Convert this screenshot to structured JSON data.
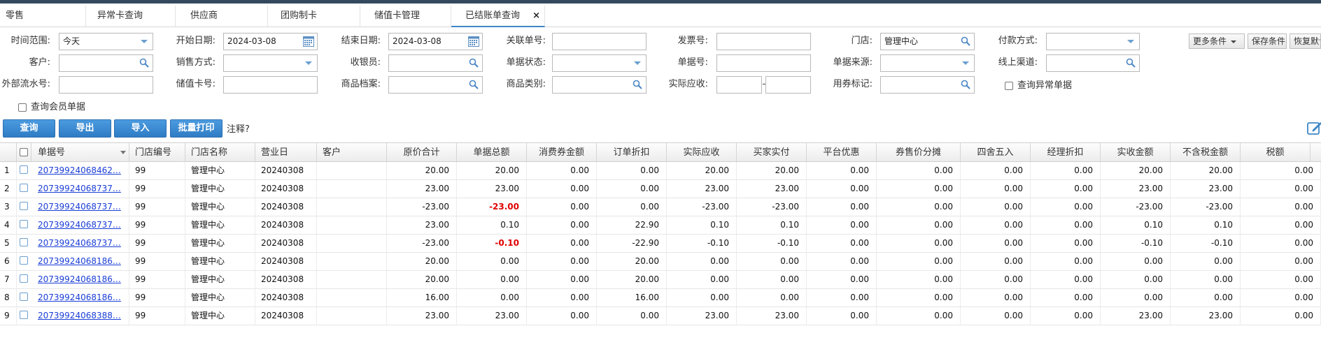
{
  "tabs": [
    {
      "label": "零售",
      "active": false
    },
    {
      "label": "异常卡查询",
      "active": false
    },
    {
      "label": "供应商",
      "active": false
    },
    {
      "label": "团购制卡",
      "active": false
    },
    {
      "label": "储值卡管理",
      "active": false
    },
    {
      "label": "已结账单查询",
      "active": true,
      "close": "×"
    }
  ],
  "form": {
    "time_range": {
      "label": "时间范围:",
      "value": "今天"
    },
    "start_date": {
      "label": "开始日期:",
      "value": "2024-03-08"
    },
    "end_date": {
      "label": "结束日期:",
      "value": "2024-03-08"
    },
    "related_no": {
      "label": "关联单号:",
      "value": ""
    },
    "invoice_no": {
      "label": "发票号:",
      "value": ""
    },
    "store": {
      "label": "门店:",
      "value": "管理中心"
    },
    "pay_method": {
      "label": "付款方式:",
      "value": ""
    },
    "customer": {
      "label": "客户:",
      "value": ""
    },
    "sale_method": {
      "label": "销售方式:",
      "value": ""
    },
    "cashier": {
      "label": "收银员:",
      "value": ""
    },
    "doc_status": {
      "label": "单据状态:",
      "value": ""
    },
    "doc_no": {
      "label": "单据号:",
      "value": ""
    },
    "doc_source": {
      "label": "单据来源:",
      "value": ""
    },
    "online_channel": {
      "label": "线上渠道:",
      "value": ""
    },
    "ext_serial": {
      "label": "外部流水号:",
      "value": ""
    },
    "stored_card": {
      "label": "储值卡号:",
      "value": ""
    },
    "goods_file": {
      "label": "商品档案:",
      "value": ""
    },
    "goods_category": {
      "label": "商品类别:",
      "value": ""
    },
    "actual_due": {
      "label": "实际应收:",
      "sep": "-"
    },
    "coupon_mark": {
      "label": "用券标记:",
      "value": ""
    },
    "query_abnormal": "查询异常单据",
    "query_member": "查询会员单据",
    "more_conditions": "更多条件",
    "save_conditions": "保存条件",
    "restore_default": "恢复默认"
  },
  "actions": {
    "query": "查询",
    "export": "导出",
    "import": "导入",
    "batch_print": "批量打印",
    "note": "注释?"
  },
  "columns": [
    "单据号",
    "门店编号",
    "门店名称",
    "营业日",
    "客户",
    "原价合计",
    "单据总额",
    "消费券金额",
    "订单折扣",
    "实际应收",
    "买家实付",
    "平台优惠",
    "券售价分摊",
    "四舍五入",
    "经理折扣",
    "实收金额",
    "不含税金额",
    "税额"
  ],
  "rows": [
    {
      "n": "1",
      "doc": "20739924068462…",
      "store_no": "99",
      "store": "管理中心",
      "day": "20240308",
      "cust": "",
      "orig": "20.00",
      "total": "20.00",
      "total_neg": false,
      "coupon": "0.00",
      "disc": "0.00",
      "due": "20.00",
      "paid": "20.00",
      "plat": "0.00",
      "share": "0.00",
      "round": "0.00",
      "mgr": "0.00",
      "recv": "20.00",
      "notax": "20.00",
      "tax": "0.00"
    },
    {
      "n": "2",
      "doc": "20739924068737…",
      "store_no": "99",
      "store": "管理中心",
      "day": "20240308",
      "cust": "",
      "orig": "23.00",
      "total": "23.00",
      "total_neg": false,
      "coupon": "0.00",
      "disc": "0.00",
      "due": "23.00",
      "paid": "23.00",
      "plat": "0.00",
      "share": "0.00",
      "round": "0.00",
      "mgr": "0.00",
      "recv": "23.00",
      "notax": "23.00",
      "tax": "0.00"
    },
    {
      "n": "3",
      "doc": "20739924068737…",
      "store_no": "99",
      "store": "管理中心",
      "day": "20240308",
      "cust": "",
      "orig": "-23.00",
      "total": "-23.00",
      "total_neg": true,
      "coupon": "0.00",
      "disc": "0.00",
      "due": "-23.00",
      "paid": "-23.00",
      "plat": "0.00",
      "share": "0.00",
      "round": "0.00",
      "mgr": "0.00",
      "recv": "-23.00",
      "notax": "-23.00",
      "tax": "0.00"
    },
    {
      "n": "4",
      "doc": "20739924068737…",
      "store_no": "99",
      "store": "管理中心",
      "day": "20240308",
      "cust": "",
      "orig": "23.00",
      "total": "0.10",
      "total_neg": false,
      "coupon": "0.00",
      "disc": "22.90",
      "due": "0.10",
      "paid": "0.10",
      "plat": "0.00",
      "share": "0.00",
      "round": "0.00",
      "mgr": "0.00",
      "recv": "0.10",
      "notax": "0.10",
      "tax": "0.00"
    },
    {
      "n": "5",
      "doc": "20739924068737…",
      "store_no": "99",
      "store": "管理中心",
      "day": "20240308",
      "cust": "",
      "orig": "-23.00",
      "total": "-0.10",
      "total_neg": true,
      "coupon": "0.00",
      "disc": "-22.90",
      "due": "-0.10",
      "paid": "-0.10",
      "plat": "0.00",
      "share": "0.00",
      "round": "0.00",
      "mgr": "0.00",
      "recv": "-0.10",
      "notax": "-0.10",
      "tax": "0.00"
    },
    {
      "n": "6",
      "doc": "20739924068186…",
      "store_no": "99",
      "store": "管理中心",
      "day": "20240308",
      "cust": "",
      "orig": "20.00",
      "total": "0.00",
      "total_neg": false,
      "coupon": "0.00",
      "disc": "20.00",
      "due": "0.00",
      "paid": "0.00",
      "plat": "0.00",
      "share": "0.00",
      "round": "0.00",
      "mgr": "0.00",
      "recv": "0.00",
      "notax": "0.00",
      "tax": "0.00"
    },
    {
      "n": "7",
      "doc": "20739924068186…",
      "store_no": "99",
      "store": "管理中心",
      "day": "20240308",
      "cust": "",
      "orig": "20.00",
      "total": "0.00",
      "total_neg": false,
      "coupon": "0.00",
      "disc": "20.00",
      "due": "0.00",
      "paid": "0.00",
      "plat": "0.00",
      "share": "0.00",
      "round": "0.00",
      "mgr": "0.00",
      "recv": "0.00",
      "notax": "0.00",
      "tax": "0.00"
    },
    {
      "n": "8",
      "doc": "20739924068186…",
      "store_no": "99",
      "store": "管理中心",
      "day": "20240308",
      "cust": "",
      "orig": "16.00",
      "total": "0.00",
      "total_neg": false,
      "coupon": "0.00",
      "disc": "16.00",
      "due": "0.00",
      "paid": "0.00",
      "plat": "0.00",
      "share": "0.00",
      "round": "0.00",
      "mgr": "0.00",
      "recv": "0.00",
      "notax": "0.00",
      "tax": "0.00"
    },
    {
      "n": "9",
      "doc": "20739924068388…",
      "store_no": "99",
      "store": "管理中心",
      "day": "20240308",
      "cust": "",
      "orig": "23.00",
      "total": "23.00",
      "total_neg": false,
      "coupon": "0.00",
      "disc": "0.00",
      "due": "23.00",
      "paid": "23.00",
      "plat": "0.00",
      "share": "0.00",
      "round": "0.00",
      "mgr": "0.00",
      "recv": "23.00",
      "notax": "23.00",
      "tax": "0.00"
    }
  ],
  "colors": {
    "accent": "#3d86c6",
    "negative": "#e00000",
    "link": "#1a3ed6",
    "topbar": "#34495e"
  }
}
